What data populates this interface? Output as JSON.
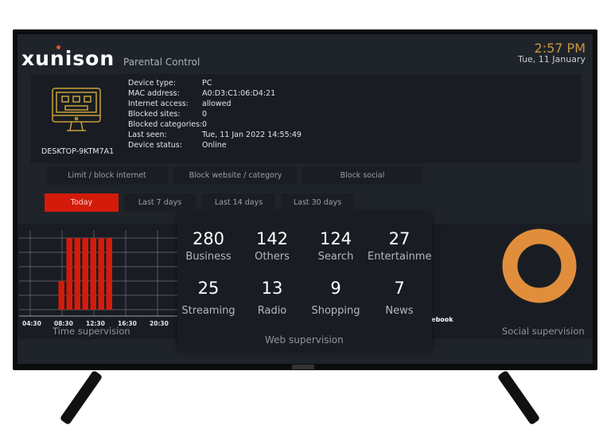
{
  "header": {
    "brand": "xunison",
    "subtitle": "Parental Control",
    "time": "2:57 PM",
    "date": "Tue, 11 January"
  },
  "device": {
    "name": "DESKTOP-9KTM7A1",
    "icon": "monitor-icon",
    "fields": [
      {
        "label": "Device type:",
        "value": "PC"
      },
      {
        "label": "MAC address:",
        "value": "A0:D3:C1:06:D4:21"
      },
      {
        "label": "Internet access:",
        "value": "allowed"
      },
      {
        "label": "Blocked sites:",
        "value": "0"
      },
      {
        "label": "Blocked categories:",
        "value": "0"
      },
      {
        "label": "Last seen:",
        "value": "Tue, 11 Jan 2022 14:55:49"
      },
      {
        "label": "Device status:",
        "value": "Online"
      }
    ]
  },
  "actions": [
    "Limit / block internet",
    "Block website / category",
    "Block social"
  ],
  "periods": {
    "items": [
      "Today",
      "Last 7 days",
      "Last 14 days",
      "Last 30 days"
    ],
    "selected": "Today"
  },
  "time_supervision": {
    "caption": "Time supervision"
  },
  "web_supervision": {
    "caption": "Web supervision",
    "categories": [
      {
        "count": "280",
        "name": "Business"
      },
      {
        "count": "142",
        "name": "Others"
      },
      {
        "count": "124",
        "name": "Search"
      },
      {
        "count": "27",
        "name": "Entertainment"
      },
      {
        "count": "25",
        "name": "Streaming"
      },
      {
        "count": "13",
        "name": "Radio"
      },
      {
        "count": "9",
        "name": "Shopping"
      },
      {
        "count": "7",
        "name": "News"
      }
    ]
  },
  "social_supervision": {
    "caption": "Social supervision",
    "legend": "Facebook",
    "color": "#e08e3c",
    "share": 100
  },
  "colors": {
    "accent": "#d41b0a",
    "time": "#c9973a",
    "bar": "#d41b0a",
    "donut": "#e08e3c"
  },
  "chart_data": {
    "type": "bar",
    "x_tick_labels": [
      "04:30",
      "08:30",
      "12:30",
      "16:30",
      "20:30"
    ],
    "x_unit": "hour of day",
    "x": [
      8,
      9,
      10,
      11,
      12,
      13,
      14
    ],
    "values": [
      24,
      60,
      60,
      60,
      60,
      60,
      60
    ],
    "ylim": [
      0,
      60
    ],
    "grid": true,
    "color": "#d41b0a"
  }
}
